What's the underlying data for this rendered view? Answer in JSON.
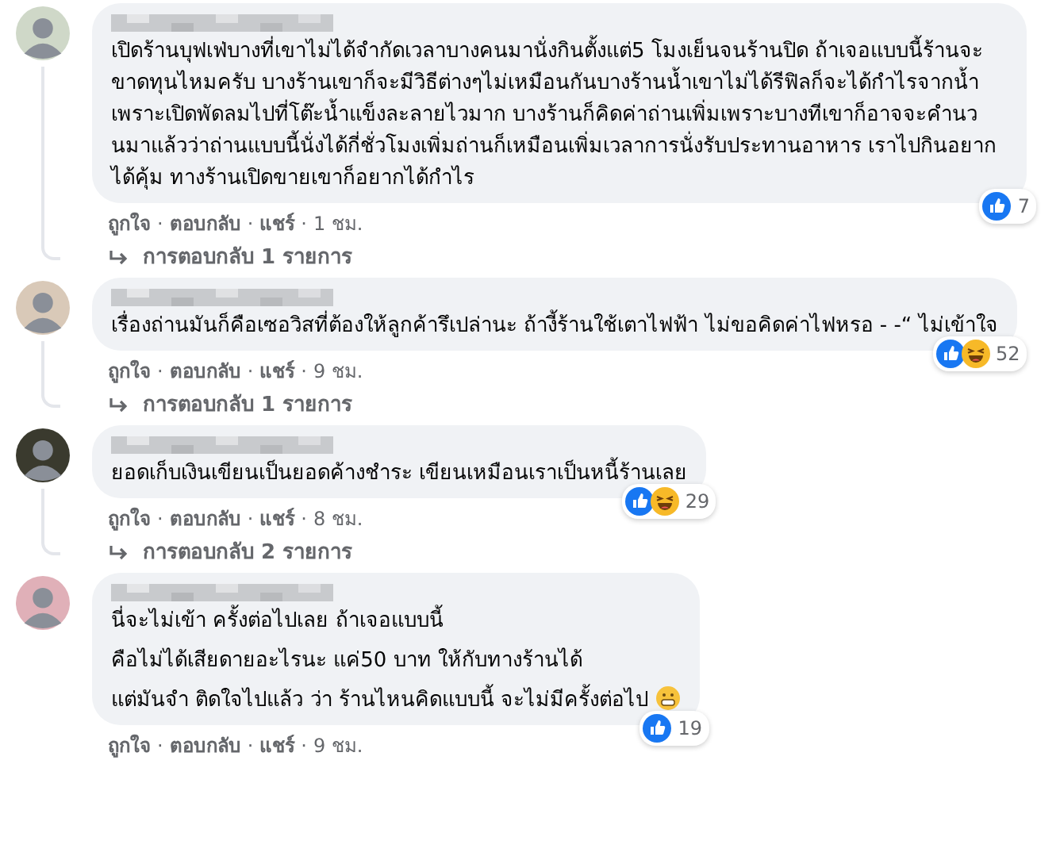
{
  "comments": [
    {
      "paragraphs": [
        "เปิดร้านบุฟเฟ่บางที่เขาไม่ได้จำกัดเวลาบางคนมานั่งกินตั้งแต่5 โมงเย็นจนร้านปิด ถ้าเจอแบบนี้ร้านจะขาดทุนไหมครับ บางร้านเขาก็จะมีวิธีต่างๆไม่เหมือนกันบางร้านน้ำเขาไม่ได้รีฟิลก็จะได้กำไรจากน้ำเพราะเปิดพัดลมไปที่โต๊ะน้ำแข็งละลายไวมาก บางร้านก็คิดค่าถ่านเพิ่มเพราะบางทีเขาก็อาจจะคำนวนมาแล้วว่าถ่านแบบนี้นั่งได้กี่ชั่วโมงเพิ่มถ่านก็เหมือนเพิ่มเวลาการนั่งรับประทานอาหาร เราไปกินอยากได้คุ้ม ทางร้านเปิดขายเขาก็อยากได้กำไร"
      ],
      "reactions": [
        {
          "kind": "like"
        }
      ],
      "reaction_count": "7",
      "meta": [
        {
          "kind": "link",
          "text": "ถูกใจ"
        },
        {
          "kind": "sep",
          "text": "·"
        },
        {
          "kind": "link",
          "text": "ตอบกลับ"
        },
        {
          "kind": "sep",
          "text": "·"
        },
        {
          "kind": "link",
          "text": "แชร์"
        },
        {
          "kind": "sep",
          "text": "·"
        },
        {
          "kind": "time",
          "text": "1 ชม."
        }
      ],
      "replies": "การตอบกลับ 1 รายการ"
    },
    {
      "paragraphs": [
        "เรื่องถ่านมันก็คือเซอวิสที่ต้องให้ลูกค้ารึเปล่านะ ถ้างี้ร้านใช้เตาไฟฟ้า ไม่ขอคิดค่าไฟหรอ - -“ ไม่เข้าใจ"
      ],
      "reactions": [
        {
          "kind": "like"
        },
        {
          "kind": "haha"
        }
      ],
      "reaction_count": "52",
      "meta": [
        {
          "kind": "link",
          "text": "ถูกใจ"
        },
        {
          "kind": "sep",
          "text": "·"
        },
        {
          "kind": "link",
          "text": "ตอบกลับ"
        },
        {
          "kind": "sep",
          "text": "·"
        },
        {
          "kind": "link",
          "text": "แชร์"
        },
        {
          "kind": "sep",
          "text": "·"
        },
        {
          "kind": "time",
          "text": "9 ชม."
        }
      ],
      "replies": "การตอบกลับ 1 รายการ"
    },
    {
      "paragraphs": [
        "ยอดเก็บเงินเขียนเป็นยอดค้างชำระ เขียนเหมือนเราเป็นหนี้ร้านเลย"
      ],
      "reactions": [
        {
          "kind": "like"
        },
        {
          "kind": "haha"
        }
      ],
      "reaction_count": "29",
      "meta": [
        {
          "kind": "link",
          "text": "ถูกใจ"
        },
        {
          "kind": "sep",
          "text": "·"
        },
        {
          "kind": "link",
          "text": "ตอบกลับ"
        },
        {
          "kind": "sep",
          "text": "·"
        },
        {
          "kind": "link",
          "text": "แชร์"
        },
        {
          "kind": "sep",
          "text": "·"
        },
        {
          "kind": "time",
          "text": "8 ชม."
        }
      ],
      "replies": "การตอบกลับ 2 รายการ"
    },
    {
      "paragraphs": [
        "นี่จะไม่เข้า ครั้งต่อไปเลย ถ้าเจอแบบนี้",
        "คือไม่ได้เสียดายอะไรนะ แค่50 บาท ให้กับทางร้านได้",
        "แต่มันจำ ติดใจไปแล้ว ว่า ร้านไหนคิดแบบนี้ จะไม่มีครั้งต่อไป"
      ],
      "trailing_emoji": {
        "kind": "grimace"
      },
      "reactions": [
        {
          "kind": "like"
        }
      ],
      "reaction_count": "19",
      "meta": [
        {
          "kind": "link",
          "text": "ถูกใจ"
        },
        {
          "kind": "sep",
          "text": "·"
        },
        {
          "kind": "link",
          "text": "ตอบกลับ"
        },
        {
          "kind": "sep",
          "text": "·"
        },
        {
          "kind": "link",
          "text": "แชร์"
        },
        {
          "kind": "sep",
          "text": "·"
        },
        {
          "kind": "time",
          "text": "9 ชม."
        }
      ]
    }
  ]
}
